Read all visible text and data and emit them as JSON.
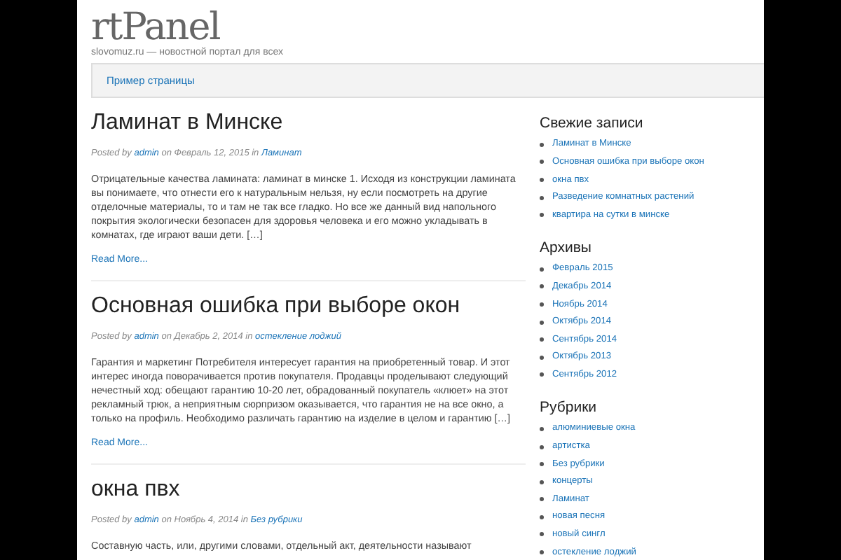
{
  "site": {
    "logo": "rtPanel",
    "tagline": "slovomuz.ru — новостной портал для всех"
  },
  "nav": [
    {
      "label": "Пример страницы"
    }
  ],
  "posts": [
    {
      "title": "Ламинат в Минске",
      "meta": {
        "prefix": "Posted by",
        "author": "admin",
        "on": "on",
        "date": "Февраль 12, 2015",
        "in": "in",
        "category": "Ламинат"
      },
      "excerpt": "Отрицательные качества ламината: ламинат в минске 1. Исходя из конструкции ламината вы понимаете, что отнести его к натуральным нельзя, ну если посмотреть на другие отделочные материалы, то и там не так все гладко. Но все же данный вид напольного покрытия экологически безопасен для здоровья человека и его можно укладывать в комнатах, где играют ваши дети. […]",
      "more": "Read More..."
    },
    {
      "title": "Основная ошибка при выборе окон",
      "meta": {
        "prefix": "Posted by",
        "author": "admin",
        "on": "on",
        "date": "Декабрь 2, 2014",
        "in": "in",
        "category": "остекление лоджий"
      },
      "excerpt": "Гарантия и маркетинг Потребителя интересует гарантия на приобретенный товар. И этот интерес иногда поворачивается против покупателя. Продавцы проделывают следующий нечестный ход: обещают гарантию 10-20 лет, обрадованный покупатель «клюет» на этот рекламный трюк, а неприятным сюрпризом оказывается, что гарантия не на все окно, а только на профиль. Необходимо различать гарантию на изделие в целом и гарантию […]",
      "more": "Read More..."
    },
    {
      "title": "окна пвх",
      "meta": {
        "prefix": "Posted by",
        "author": "admin",
        "on": "on",
        "date": "Ноябрь 4, 2014",
        "in": "in",
        "category": "Без рубрики"
      },
      "excerpt": "Составную часть, или, другими словами, отдельный акт, деятельности называют"
    }
  ],
  "sidebar": [
    {
      "title": "Свежие записи",
      "items": [
        "Ламинат в Минске",
        "Основная ошибка при выборе окон",
        "окна пвх",
        "Разведение комнатных растений",
        "квартира на сутки в минске"
      ]
    },
    {
      "title": "Архивы",
      "items": [
        "Февраль 2015",
        "Декабрь 2014",
        "Ноябрь 2014",
        "Октябрь 2014",
        "Сентябрь 2014",
        "Октябрь 2013",
        "Сентябрь 2012"
      ]
    },
    {
      "title": "Рубрики",
      "items": [
        "алюминиевые окна",
        "артистка",
        "Без рубрики",
        "концерты",
        "Ламинат",
        "новая песня",
        "новый сингл",
        "остекление лоджий"
      ]
    }
  ]
}
